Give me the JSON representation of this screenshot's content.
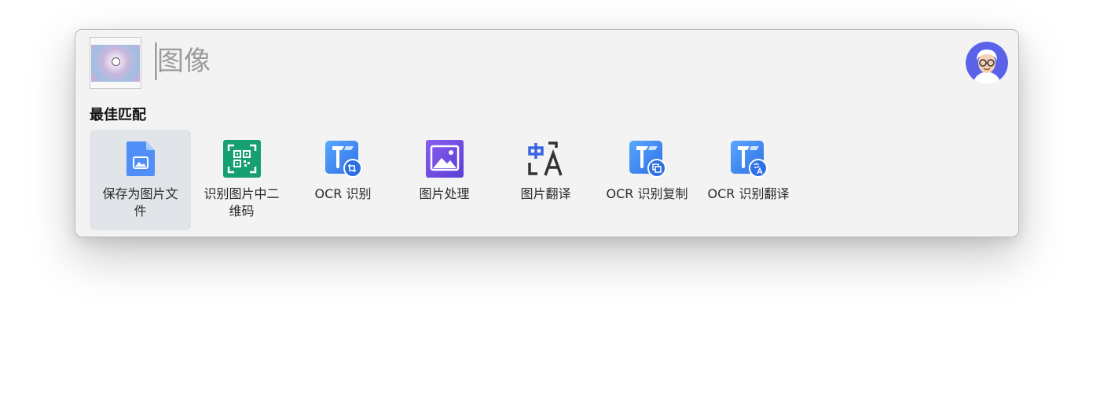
{
  "search": {
    "value": "",
    "placeholder": "图像"
  },
  "best_match": {
    "title": "最佳匹配",
    "items": [
      {
        "label": "保存为图片文件",
        "icon": "image-file-icon",
        "selected": true
      },
      {
        "label": "识别图片中二维码",
        "icon": "qr-code-icon",
        "selected": false
      },
      {
        "label": "OCR 识别",
        "icon": "ocr-crop-icon",
        "selected": false
      },
      {
        "label": "图片处理",
        "icon": "image-edit-icon",
        "selected": false
      },
      {
        "label": "图片翻译",
        "icon": "translate-icon",
        "selected": false
      },
      {
        "label": "OCR 识别复制",
        "icon": "ocr-copy-icon",
        "selected": false
      },
      {
        "label": "OCR 识别翻译",
        "icon": "ocr-translate-icon",
        "selected": false
      }
    ]
  },
  "colors": {
    "panel_bg": "#f3f3f3",
    "selected_bg": "#e1e4e9",
    "accent_blue": "#3b86f0",
    "qr_green": "#16a06f",
    "image_purple": "#7b4ee0"
  }
}
